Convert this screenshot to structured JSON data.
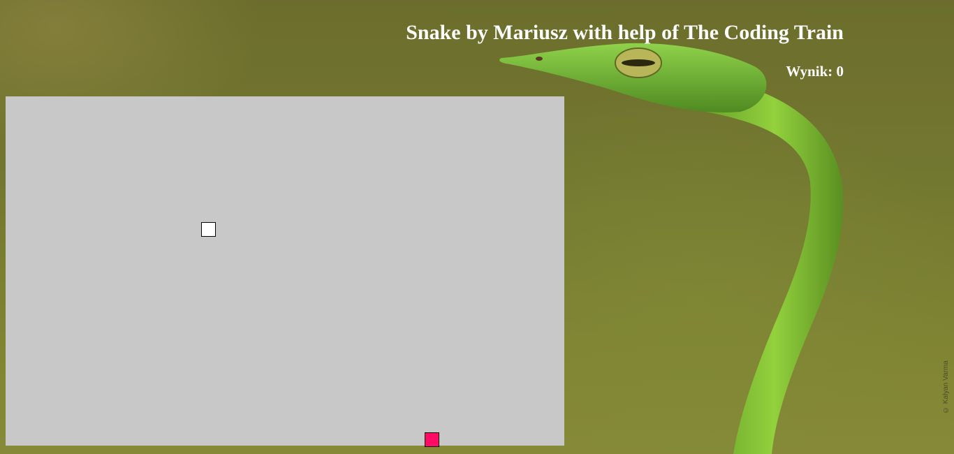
{
  "header": {
    "title": "Snake by Mariusz with help of The Coding Train",
    "score_text": "Wynik: 0"
  },
  "background": {
    "image_subject": "green-vine-snake-photo",
    "credit": "© Kalyan Varma"
  },
  "game": {
    "board_color": "#c8c8c8",
    "snake_color": "#ffffff",
    "food_color": "#ff0a64",
    "score": 0
  }
}
